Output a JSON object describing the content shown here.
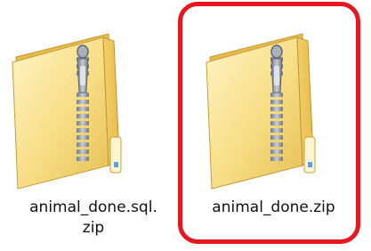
{
  "files": [
    {
      "label_line1": "animal_done.sql.",
      "label_line2": "zip",
      "icon": "zip-folder-icon",
      "selected": false
    },
    {
      "label_line1": "animal_done.zip",
      "label_line2": "",
      "icon": "zip-folder-icon",
      "selected": true
    }
  ],
  "colors": {
    "highlight": "#e8161e",
    "folder_light": "#fce9a0",
    "folder_dark": "#e0b84e",
    "zipper": "#8c949e"
  }
}
